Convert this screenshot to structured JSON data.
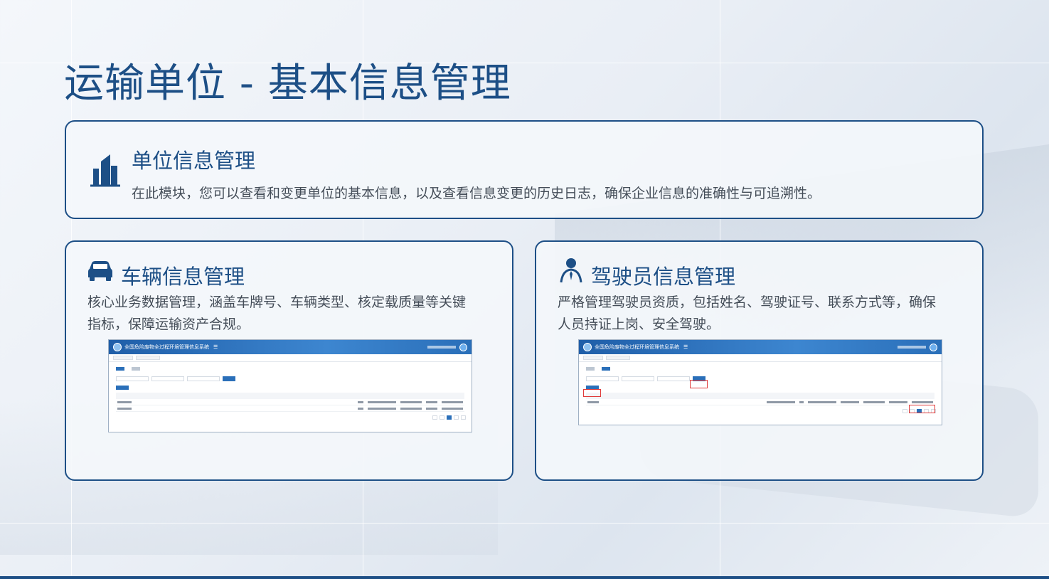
{
  "page": {
    "title": "运输单位 - 基本信息管理"
  },
  "sections": {
    "unit": {
      "heading": "单位信息管理",
      "description": "在此模块，您可以查看和变更单位的基本信息，以及查看信息变更的历史日志，确保企业信息的准确性与可追溯性。",
      "icon": "building-icon"
    },
    "vehicle": {
      "heading": "车辆信息管理",
      "description_lines": [
        "核心业务数据管理，涵盖车牌号、车辆类型、核定载质量等关键",
        "指标，保障运输资产合规。"
      ],
      "icon": "car-icon"
    },
    "driver": {
      "heading": "驾驶员信息管理",
      "description_lines": [
        "严格管理驾驶员资质，包括姓名、驾驶证号、联系方式等，确保",
        "人员持证上岗、安全驾驶。"
      ],
      "icon": "driver-icon"
    }
  },
  "mini_screens": {
    "system_title": "全国危险废物全过程环境管理信息系统",
    "menu_glyph": "☰"
  },
  "colors": {
    "primary": "#1d4f86",
    "highlight": "#e03b3b"
  }
}
